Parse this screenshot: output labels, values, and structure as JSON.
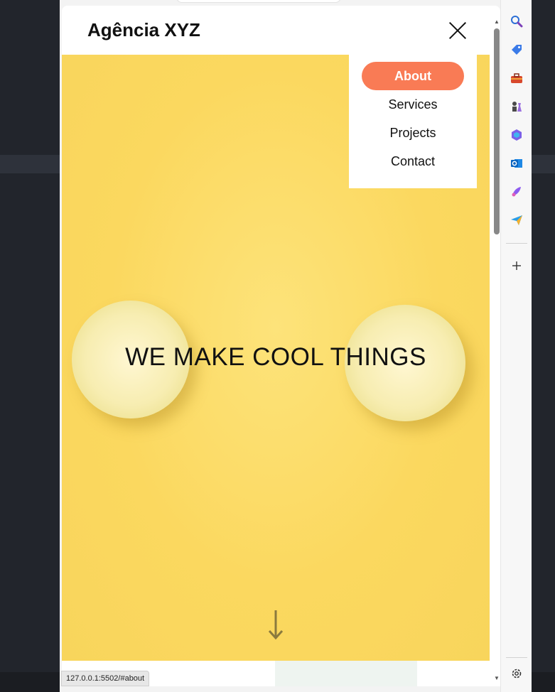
{
  "site": {
    "brand": "Agência XYZ",
    "hero_title": "WE MAKE COOL THINGS"
  },
  "nav": {
    "items": [
      {
        "label": "About",
        "active": true
      },
      {
        "label": "Services",
        "active": false
      },
      {
        "label": "Projects",
        "active": false
      },
      {
        "label": "Contact",
        "active": false
      }
    ]
  },
  "status_bar": {
    "url": "127.0.0.1:5502/#about"
  },
  "colors": {
    "accent": "#f97b55",
    "hero_background": "#fbd85f"
  },
  "sidebar": {
    "icons": [
      "search-icon",
      "shopping-tag-icon",
      "toolbox-icon",
      "chess-icon",
      "copilot-icon",
      "outlook-icon",
      "designer-icon",
      "send-icon",
      "add-icon",
      "settings-icon"
    ]
  }
}
